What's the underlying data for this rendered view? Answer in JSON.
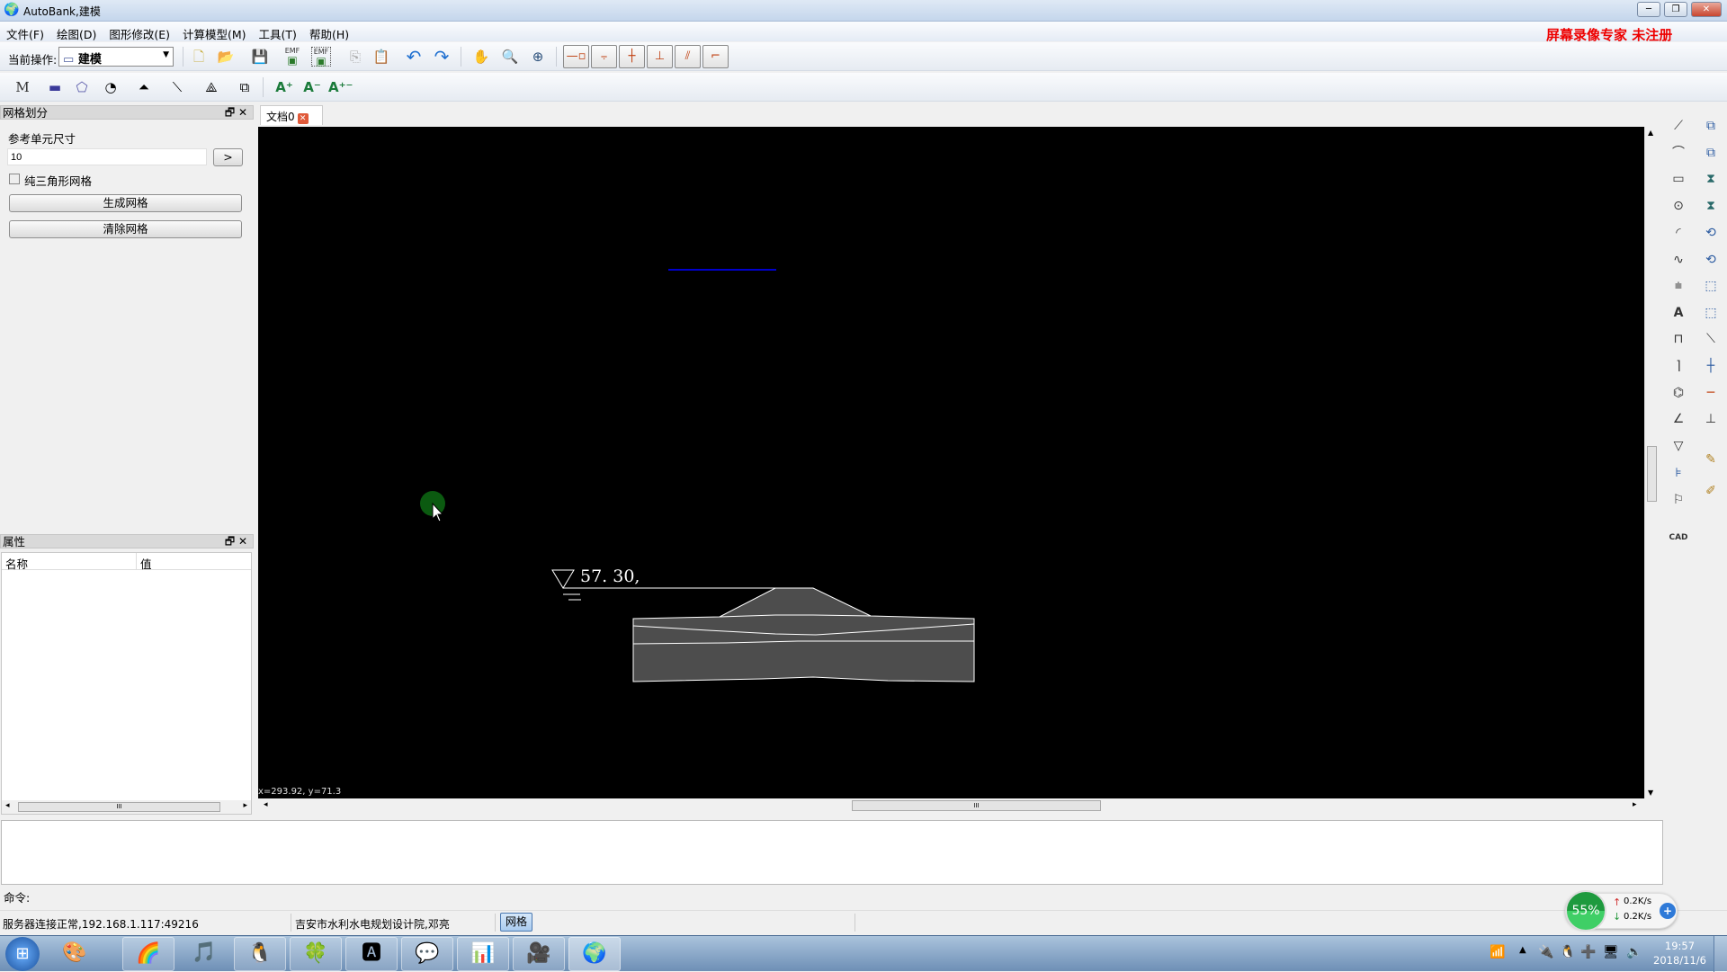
{
  "window": {
    "title": "AutoBank,建模",
    "min": "─",
    "restore": "❐",
    "close": "✕"
  },
  "menu": [
    "文件(F)",
    "绘图(D)",
    "图形修改(E)",
    "计算模型(M)",
    "工具(T)",
    "帮助(H)"
  ],
  "watermark": "屏幕录像专家  未注册",
  "toolbar": {
    "current_op_label": "当前操作:",
    "current_op_value": "建模",
    "emf1": "EMF",
    "emf2": "EMF"
  },
  "toolbar2": {
    "m_label": "M",
    "font_up": "A⁺",
    "font_down": "A⁻",
    "font_both": "A⁺⁻"
  },
  "mesh_panel": {
    "title": "网格划分",
    "ref_size_label": "参考单元尺寸",
    "ref_size_value": "10",
    "go_button": ">",
    "triangle_only_label": "纯三角形网格",
    "triangle_only_checked": false,
    "generate_button": "生成网格",
    "clear_button": "清除网格"
  },
  "props_panel": {
    "title": "属性",
    "col_name": "名称",
    "col_value": "值",
    "scroll_grip": "III"
  },
  "doc_tab": {
    "label": "文档0"
  },
  "canvas": {
    "water_level_label": "57. 30,",
    "coord_readout": "x=293.92, y=71.3",
    "hscroll_grip": "III",
    "background": "#000000",
    "dam_fill": "#4d4d4d",
    "line_color": "#0000cc"
  },
  "command": {
    "label": "命令:"
  },
  "status": {
    "server": "服务器连接正常,192.168.1.117:49216",
    "org_user": "吉安市水利水电规划设计院,邓亮",
    "mesh_button": "网格"
  },
  "netmon": {
    "percent": "55%",
    "up": "0.2K/s",
    "down": "0.2K/s"
  },
  "clock": {
    "time": "19:57",
    "date": "2018/11/6"
  }
}
